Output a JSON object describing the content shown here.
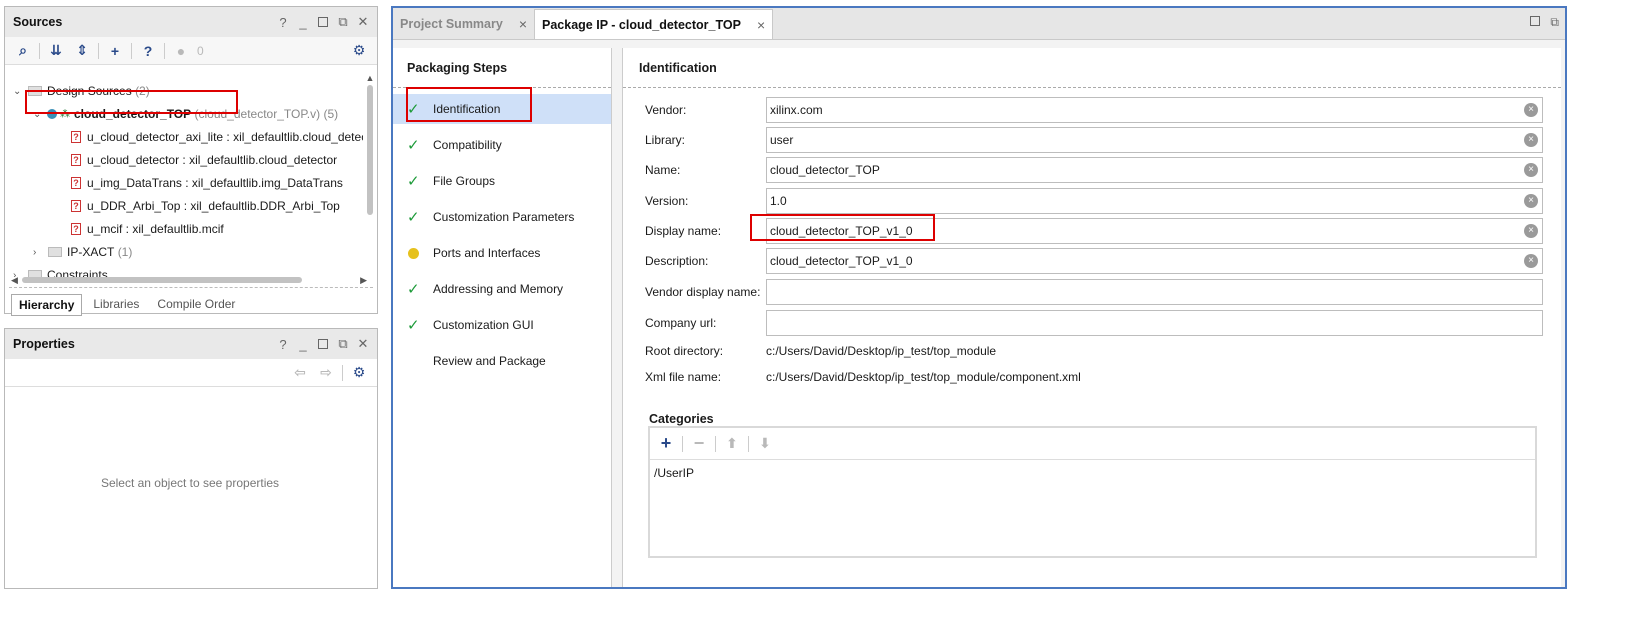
{
  "sources": {
    "title": "Sources",
    "tree": {
      "design_sources": "Design Sources",
      "design_sources_count": "(2)",
      "top": {
        "name": "cloud_detector_TOP",
        "file": "(cloud_detector_TOP.v)",
        "count": "(5)"
      },
      "children": [
        "u_cloud_detector_axi_lite : xil_defaultlib.cloud_detect",
        "u_cloud_detector : xil_defaultlib.cloud_detector",
        "u_img_DataTrans : xil_defaultlib.img_DataTrans",
        "u_DDR_Arbi_Top : xil_defaultlib.DDR_Arbi_Top",
        "u_mcif : xil_defaultlib.mcif"
      ],
      "ip_xact": "IP-XACT",
      "ip_xact_count": "(1)",
      "constraints": "Constraints"
    },
    "status_count": "0",
    "tabs": [
      "Hierarchy",
      "Libraries",
      "Compile Order"
    ]
  },
  "properties": {
    "title": "Properties",
    "empty_text": "Select an object to see properties"
  },
  "main": {
    "tabs": [
      "Project Summary",
      "Package IP - cloud_detector_TOP"
    ],
    "steps_title": "Packaging Steps",
    "steps": [
      {
        "label": "Identification",
        "status": "done"
      },
      {
        "label": "Compatibility",
        "status": "done"
      },
      {
        "label": "File Groups",
        "status": "done"
      },
      {
        "label": "Customization Parameters",
        "status": "done"
      },
      {
        "label": "Ports and Interfaces",
        "status": "warning"
      },
      {
        "label": "Addressing and Memory",
        "status": "done"
      },
      {
        "label": "Customization GUI",
        "status": "done"
      },
      {
        "label": "Review and Package",
        "status": "none"
      }
    ],
    "content_title": "Identification",
    "fields": {
      "vendor": {
        "label": "Vendor:",
        "value": "xilinx.com"
      },
      "library": {
        "label": "Library:",
        "value": "user"
      },
      "name": {
        "label": "Name:",
        "value": "cloud_detector_TOP"
      },
      "version": {
        "label": "Version:",
        "value": "1.0"
      },
      "display_name": {
        "label": "Display name:",
        "value": "cloud_detector_TOP_v1_0"
      },
      "description": {
        "label": "Description:",
        "value": "cloud_detector_TOP_v1_0"
      },
      "vendor_display_name": {
        "label": "Vendor display name:",
        "value": ""
      },
      "company_url": {
        "label": "Company url:",
        "value": ""
      },
      "root_directory": {
        "label": "Root directory:",
        "value": "c:/Users/David/Desktop/ip_test/top_module"
      },
      "xml_file_name": {
        "label": "Xml file name:",
        "value": "c:/Users/David/Desktop/ip_test/top_module/component.xml"
      }
    },
    "categories_title": "Categories",
    "categories": [
      "/UserIP"
    ]
  },
  "colors": {
    "selection": "#cfe0f8",
    "accent_border": "#4a78c0",
    "highlight_box": "#d00000",
    "check": "#1e9b3a",
    "warning": "#e6c11d"
  }
}
